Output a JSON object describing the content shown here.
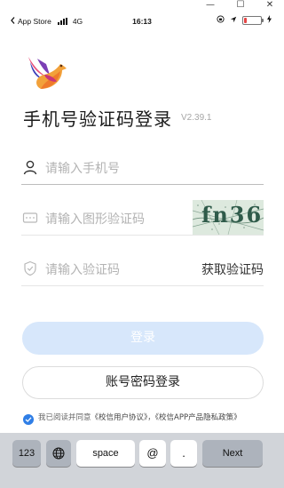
{
  "window": {
    "restore_glyph": "☐",
    "close_glyph": "✕",
    "minimize_glyph": "—"
  },
  "status_bar": {
    "carrier_back": "App Store",
    "network": "4G",
    "time": "16:13",
    "battery_color": "#e64545",
    "battery_level_percent": 15
  },
  "login": {
    "title": "手机号验证码登录",
    "version": "V2.39.1",
    "phone_placeholder": "请输入手机号",
    "captcha_placeholder": "请输入图形验证码",
    "captcha_text": "fn36",
    "sms_placeholder": "请输入验证码",
    "get_code_label": "获取验证码",
    "login_button": "登录",
    "password_login_button": "账号密码登录",
    "agreement_prefix": "我已阅读并同意",
    "user_agreement": "《校信用户协议》",
    "separator": "，",
    "privacy_policy": "《校信APP产品隐私政策》"
  },
  "keyboard": {
    "key_123": "123",
    "key_space": "space",
    "key_at": "@",
    "key_dot": ".",
    "key_next": "Next"
  },
  "colors": {
    "accent": "#2f7ee6",
    "login_button_disabled": "#d7e7fb"
  }
}
